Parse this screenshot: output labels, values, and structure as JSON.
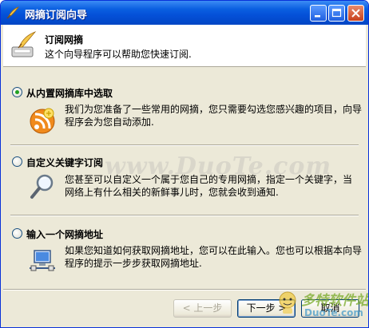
{
  "window": {
    "title": "网摘订阅向导"
  },
  "header": {
    "title": "订阅网摘",
    "description": "这个向导程序可以帮助您快速订阅."
  },
  "options": [
    {
      "label": "从内置网摘库中选取",
      "checked": true,
      "icon": "rss-feed-icon",
      "description_line1": "我们为您准备了一些常用的网摘，您只需要勾选您感兴趣的项目，向导",
      "description_line2": "程序会为您自动添加."
    },
    {
      "label": "自定义关键字订阅",
      "checked": false,
      "icon": "magnifier-icon",
      "description_line1": "您甚至可以自定义一个属于您自己的专用网摘，指定一个关键字，当",
      "description_line2": "网络上有什么相关的新鲜事儿时，您就会收到通知."
    },
    {
      "label": "输入一个网摘地址",
      "checked": false,
      "icon": "network-computer-icon",
      "description_line1": "如果您知道如何获取网摘地址，您可以在此输入。您也可以根据本向导",
      "description_line2": "程序的提示一步步获取网摘地址."
    }
  ],
  "buttons": {
    "back": "< 上一步",
    "next": "下一步 >",
    "cancel": "取消"
  },
  "watermark": {
    "center": "www.DuoTe.com",
    "corner_cn": "多特软件站",
    "corner_en": "DuoTe.com"
  },
  "colors": {
    "titlebar": "#0450d8",
    "face": "#ece9d8",
    "radio_dot": "#21a121"
  }
}
